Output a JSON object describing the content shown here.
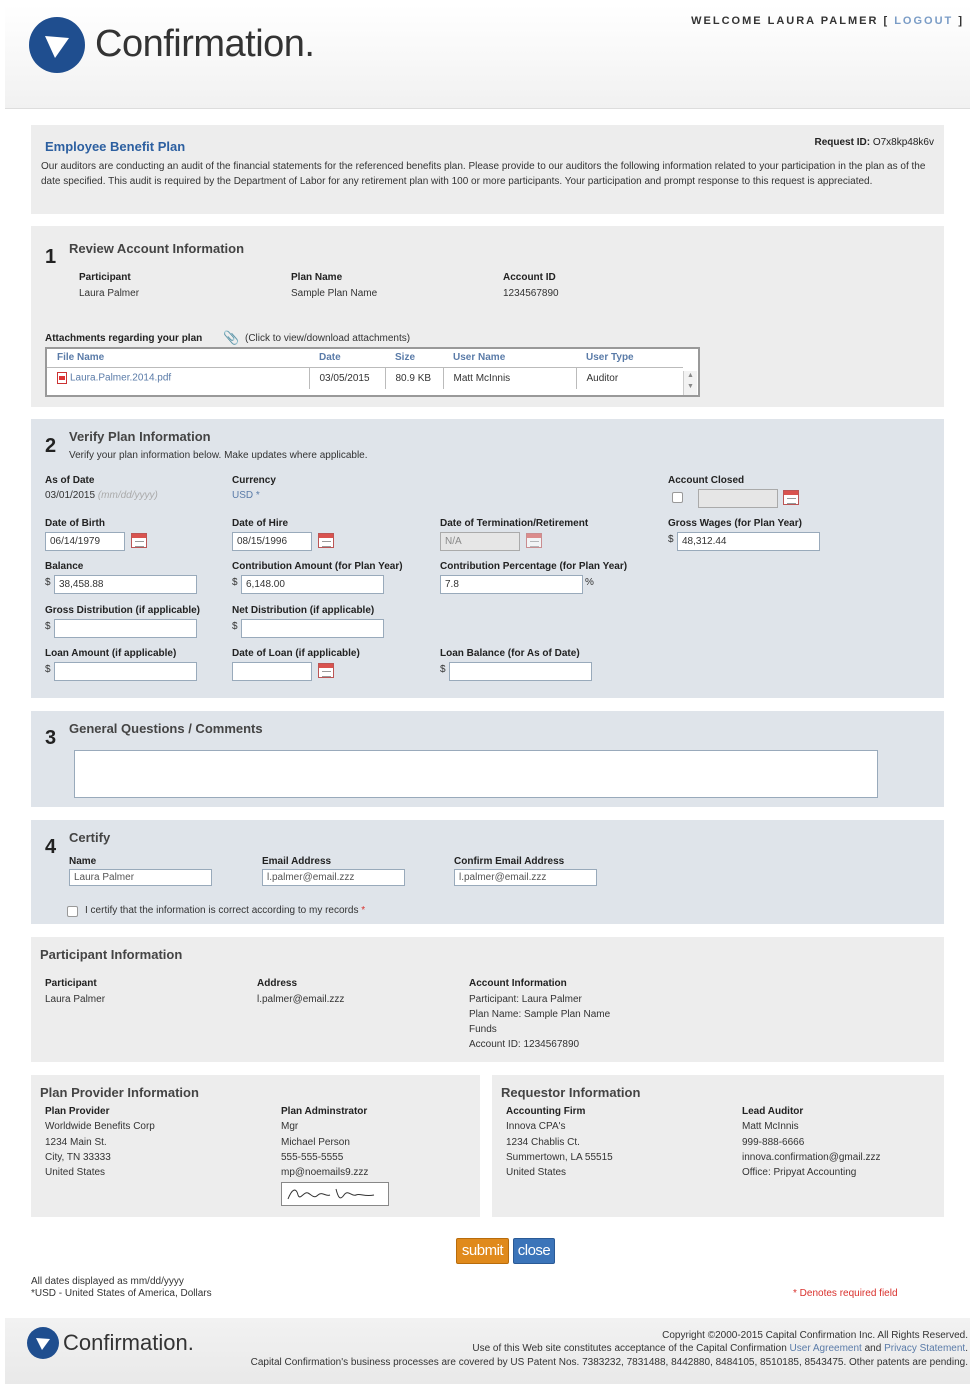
{
  "header": {
    "logo_text": "Confirmation.",
    "welcome": "WELCOME LAURA PALMER",
    "logout": "LOGOUT"
  },
  "intro": {
    "title": "Employee Benefit Plan",
    "request_id_label": "Request ID:",
    "request_id": "O7x8kp48k6v",
    "text": "Our auditors are conducting an audit of the financial statements for the referenced benefits plan. Please provide to our auditors the following information related to your participation in the plan as of the date specified. This audit is required by the Department of Labor for any retirement plan with 100 or more participants. Your participation and prompt response to this request is appreciated."
  },
  "section1": {
    "number": "1",
    "title": "Review Account Information",
    "participant_label": "Participant",
    "participant": "Laura Palmer",
    "plan_name_label": "Plan Name",
    "plan_name": "Sample Plan Name",
    "account_id_label": "Account ID",
    "account_id": "1234567890",
    "attachments_label": "Attachments regarding your plan",
    "attachments_hint": "(Click to view/download attachments)",
    "columns": [
      "File Name",
      "Date",
      "Size",
      "User Name",
      "User Type"
    ],
    "rows": [
      {
        "file": "Laura.Palmer.2014.pdf",
        "date": "03/05/2015",
        "size": "80.9 KB",
        "user": "Matt McInnis",
        "type": "Auditor"
      }
    ]
  },
  "section2": {
    "number": "2",
    "title": "Verify Plan Information",
    "subtitle": "Verify your plan information below. Make updates where applicable.",
    "as_of_label": "As of Date",
    "as_of_value": "03/01/2015",
    "as_of_hint": "(mm/dd/yyyy)",
    "currency_label": "Currency",
    "currency_value": "USD",
    "currency_mark": "*",
    "account_closed_label": "Account Closed",
    "dob_label": "Date of Birth",
    "dob": "06/14/1979",
    "hire_label": "Date of Hire",
    "hire": "08/15/1996",
    "term_label": "Date of Termination/Retirement",
    "term": "N/A",
    "wages_label": "Gross Wages (for Plan Year)",
    "wages": "48,312.44",
    "balance_label": "Balance",
    "balance": "38,458.88",
    "contrib_label": "Contribution Amount (for Plan Year)",
    "contrib": "6,148.00",
    "contrib_pct_label": "Contribution Percentage (for Plan Year)",
    "contrib_pct": "7.8",
    "pct_sign": "%",
    "gross_dist_label": "Gross Distribution (if applicable)",
    "net_dist_label": "Net Distribution (if applicable)",
    "loan_amt_label": "Loan Amount (if applicable)",
    "loan_date_label": "Date of Loan (if applicable)",
    "loan_bal_label": "Loan Balance (for As of Date)",
    "dollar": "$"
  },
  "section3": {
    "number": "3",
    "title": "General Questions / Comments"
  },
  "section4": {
    "number": "4",
    "title": "Certify",
    "name_label": "Name",
    "name": "Laura Palmer",
    "email_label": "Email Address",
    "email": "l.palmer@email.zzz",
    "confirm_label": "Confirm Email Address",
    "confirm": "l.palmer@email.zzz",
    "certify_text": "I certify that the information is correct according to my records",
    "required_mark": "*"
  },
  "participant_info": {
    "title": "Participant Information",
    "participant_label": "Participant",
    "participant": "Laura Palmer",
    "address_label": "Address",
    "address": "l.palmer@email.zzz",
    "account_label": "Account Information",
    "account_lines": [
      "Participant: Laura Palmer",
      "Plan Name: Sample Plan Name",
      "Funds",
      "Account ID: 1234567890"
    ]
  },
  "provider_info": {
    "title": "Plan Provider Information",
    "provider_label": "Plan Provider",
    "provider_lines": [
      "Worldwide Benefits Corp",
      "1234 Main St.",
      "City, TN 33333",
      "United States"
    ],
    "admin_label": "Plan Adminstrator",
    "admin_lines": [
      "Mgr",
      "Michael Person",
      "555-555-5555",
      "mp@noemails9.zzz"
    ]
  },
  "requestor_info": {
    "title": "Requestor Information",
    "firm_label": "Accounting Firm",
    "firm_lines": [
      "Innova CPA's",
      "1234 Chablis Ct.",
      "Summertown, LA 55515",
      "United States"
    ],
    "auditor_label": "Lead Auditor",
    "auditor_lines": [
      "Matt McInnis",
      "999-888-6666",
      "innova.confirmation@gmail.zzz",
      "Office: Pripyat Accounting"
    ]
  },
  "buttons": {
    "submit": "submit",
    "close": "close"
  },
  "notes": {
    "dates": "All dates displayed as mm/dd/yyyy",
    "usd": "*USD - United States of America, Dollars",
    "required": "* Denotes required field"
  },
  "footer": {
    "logo_text": "Confirmation.",
    "copyright": "Copyright ©2000-2015 Capital Confirmation Inc. All Rights Reserved.",
    "use_prefix": "Use of this Web site constitutes acceptance of the Capital Confirmation",
    "user_agreement": "User Agreement",
    "and": "and",
    "privacy": "Privacy Statement",
    "patents": "Capital Confirmation's business processes are covered by US Patent Nos. 7383232, 7831488, 8442880, 8484105, 8510185, 8543475. Other patents are pending."
  },
  "colors": {
    "brand": "#1f4e8f",
    "link": "#5a7ba8",
    "submit": "#e08a1c",
    "close": "#3b74b9",
    "panel_blue": "#dfe4ea",
    "panel_gray": "#ededed",
    "required": "#d9302c"
  }
}
